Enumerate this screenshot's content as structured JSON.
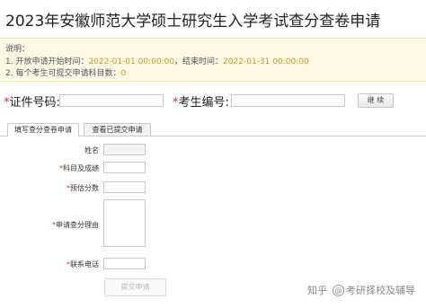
{
  "page": {
    "title": "2023年安徽师范大学硕士研究生入学考试查分查卷申请"
  },
  "notice": {
    "heading": "说明：",
    "line1_prefix": "1. 开放申请开始时间：",
    "start_time": "2022-01-01 00:00:00",
    "line1_middle": "，结束时间：",
    "end_time": "2022-01-31 00:00:00",
    "line2_prefix": "2. 每个考生可提交申请科目数：",
    "subject_count": "0"
  },
  "search": {
    "required_mark": "*",
    "id_label": "证件号码:",
    "id_value": "",
    "exam_label": "考生编号:",
    "exam_value": "",
    "continue_button": "继 续"
  },
  "tabs": [
    {
      "label": "填写查分查卷申请",
      "active": true
    },
    {
      "label": "查看已提交申请",
      "active": false
    }
  ],
  "form": {
    "name_label": "姓名",
    "subject_label": "科目及成绩",
    "expected_label": "预估分数",
    "reason_label": "申请查分理由",
    "phone_label": "联系电话",
    "required_mark": "*",
    "submit_button": "提交申请"
  },
  "watermark": {
    "brand": "知乎",
    "at_symbol": "@",
    "author": "考研择校及辅导"
  }
}
